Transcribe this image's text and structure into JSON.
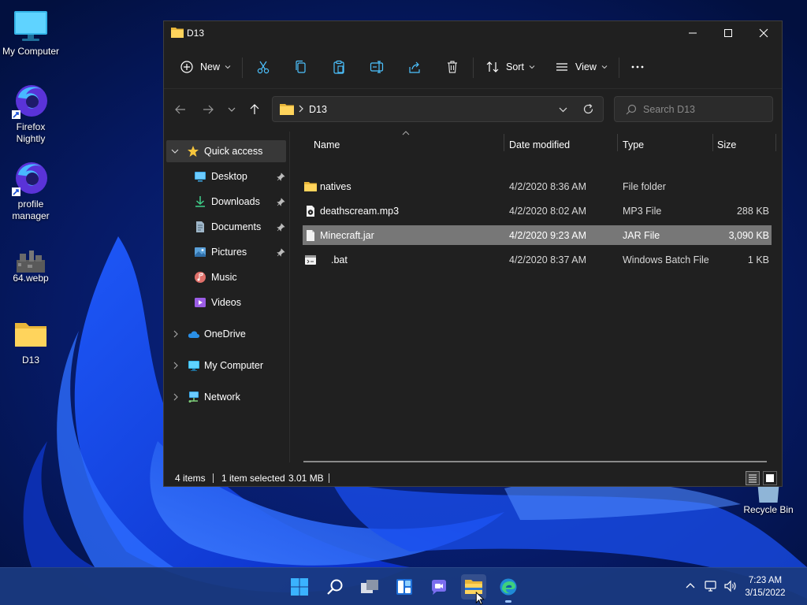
{
  "desktop": {
    "icons": [
      {
        "label_line1": "My Computer",
        "label_line2": ""
      },
      {
        "label_line1": "Firefox",
        "label_line2": "Nightly"
      },
      {
        "label_line1": "profile",
        "label_line2": "manager"
      },
      {
        "label_line1": "64.webp",
        "label_line2": ""
      },
      {
        "label_line1": "D13",
        "label_line2": ""
      }
    ],
    "recycle_bin": "Recycle Bin"
  },
  "window": {
    "title": "D13",
    "toolbar": {
      "new_label": "New",
      "sort_label": "Sort",
      "view_label": "View"
    },
    "address": {
      "path": "D13",
      "search_placeholder": "Search D13"
    },
    "navigation": {
      "quick_access": "Quick access",
      "items": [
        {
          "label": "Desktop",
          "pinned": true
        },
        {
          "label": "Downloads",
          "pinned": true
        },
        {
          "label": "Documents",
          "pinned": true
        },
        {
          "label": "Pictures",
          "pinned": true
        },
        {
          "label": "Music",
          "pinned": false
        },
        {
          "label": "Videos",
          "pinned": false
        }
      ],
      "onedrive": "OneDrive",
      "my_computer": "My Computer",
      "network": "Network"
    },
    "columns": {
      "name": "Name",
      "date": "Date modified",
      "type": "Type",
      "size": "Size"
    },
    "files": [
      {
        "name": "natives",
        "date": "4/2/2020 8:36 AM",
        "type": "File folder",
        "size": "",
        "icon": "folder-icon"
      },
      {
        "name": "deathscream.mp3",
        "date": "4/2/2020 8:02 AM",
        "type": "MP3 File",
        "size": "288 KB",
        "icon": "audio-file-icon"
      },
      {
        "name": "Minecraft.jar",
        "date": "4/2/2020 9:23 AM",
        "type": "JAR File",
        "size": "3,090 KB",
        "icon": "file-icon",
        "selected": true
      },
      {
        "name": ".bat",
        "date": "4/2/2020 8:37 AM",
        "type": "Windows Batch File",
        "size": "1 KB",
        "icon": "batch-file-icon"
      }
    ],
    "status": {
      "item_count": "4 items",
      "selection": "1 item selected",
      "selection_size": "3.01 MB"
    }
  },
  "taskbar": {
    "time": "7:23 AM",
    "date": "3/15/2022"
  }
}
